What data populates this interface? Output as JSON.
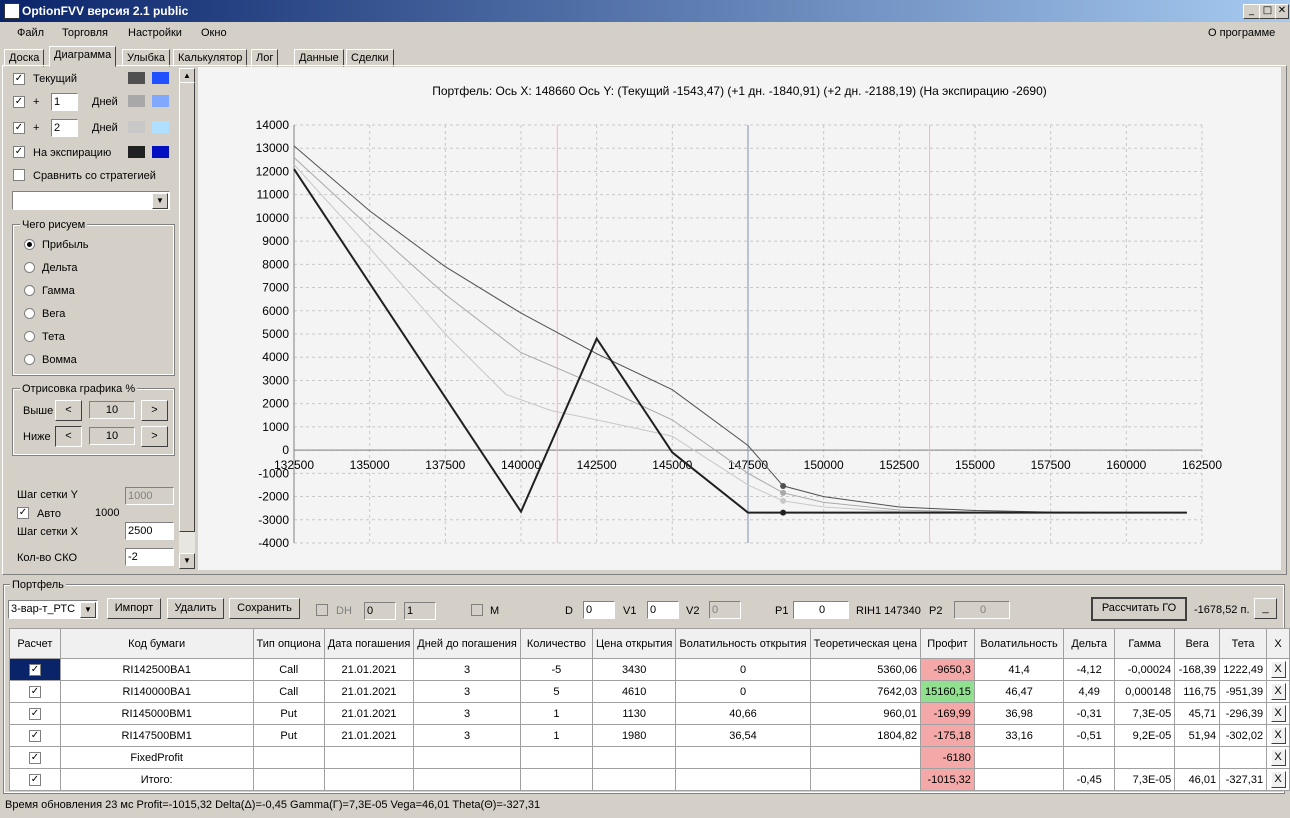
{
  "window": {
    "title": "OptionFVV версия 2.1 public",
    "min": "_",
    "max": "□",
    "close": "✕"
  },
  "menu": {
    "items": [
      "Файл",
      "Торговля",
      "Настройки",
      "Окно"
    ],
    "about": "О программе"
  },
  "tabs": [
    "Доска",
    "Диаграмма",
    "Улыбка",
    "Калькулятор",
    "Лог",
    "Данные",
    "Сделки"
  ],
  "left": {
    "current": {
      "label": "Текущий",
      "checked": true,
      "color1": "#505050",
      "color2": "#2050ff"
    },
    "plus1": {
      "plus": "+",
      "value": "1",
      "days": "Дней",
      "checked": true,
      "color1": "#a8a8a8",
      "color2": "#80a8ff"
    },
    "plus2": {
      "plus": "+",
      "value": "2",
      "days": "Дней",
      "checked": true,
      "color1": "#c8c8c8",
      "color2": "#b0e0ff"
    },
    "expiration": {
      "label": "На экспирацию",
      "checked": true,
      "color1": "#202020",
      "color2": "#0010c0"
    },
    "compare": {
      "label": "Сравнить со стратегией",
      "checked": false
    },
    "draw_group": {
      "title": "Чего рисуем",
      "options": [
        "Прибыль",
        "Дельта",
        "Гамма",
        "Вега",
        "Тета",
        "Вомма"
      ],
      "selected": 0
    },
    "render_group": {
      "title": "Отрисовка графика %",
      "upper_label": "Выше",
      "upper_value": "10",
      "lower_label": "Ниже",
      "lower_value": "10",
      "less": "<",
      "more": ">"
    },
    "grid_y": {
      "label": "Шаг сетки Y",
      "value": "1000"
    },
    "auto": {
      "label": "Авто",
      "value": "1000",
      "checked": true
    },
    "grid_x": {
      "label": "Шаг сетки X",
      "value": "2500"
    },
    "sko": {
      "label": "Кол-во СКО",
      "value": "-2"
    }
  },
  "chart_header": "Портфель:  Ось X:  148660  Ось Y:   (Текущий -1543,47)   (+1 дн. -1840,91)   (+2 дн. -2188,19)   (На экспирацию -2690)",
  "chart_data": {
    "type": "line",
    "xlim": [
      132500,
      162500
    ],
    "ylim": [
      -4000,
      14000
    ],
    "x_ticks": [
      132500,
      135000,
      137500,
      140000,
      142500,
      145000,
      147500,
      150000,
      152500,
      155000,
      157500,
      160000,
      162500
    ],
    "y_ticks": [
      14000,
      13000,
      12000,
      11000,
      10000,
      9000,
      8000,
      7000,
      6000,
      5000,
      4000,
      3000,
      2000,
      1000,
      0,
      -1000,
      -2000,
      -3000,
      -4000
    ],
    "grid": true,
    "cursor_x": 147500,
    "sko_lines_x": [
      141200,
      153500
    ],
    "series": [
      {
        "color": "#505050",
        "width": 1,
        "x": [
          132500,
          135000,
          137500,
          140000,
          142500,
          145000,
          147500,
          148660,
          150000,
          152500,
          155000,
          157500,
          160000,
          162000
        ],
        "y": [
          13100,
          10300,
          7900,
          5900,
          4150,
          2600,
          200,
          -1543,
          -2000,
          -2450,
          -2600,
          -2670,
          -2690,
          -2690
        ]
      },
      {
        "color": "#a8a8a8",
        "width": 1,
        "x": [
          132500,
          135000,
          137500,
          140000,
          142500,
          145000,
          147500,
          148660,
          150000,
          152500,
          155000,
          157500,
          160000,
          162000
        ],
        "y": [
          12600,
          9600,
          6700,
          4200,
          2800,
          1300,
          -1000,
          -1840,
          -2250,
          -2580,
          -2670,
          -2690,
          -2690,
          -2690
        ]
      },
      {
        "color": "#c8c8c8",
        "width": 1,
        "x": [
          132500,
          135000,
          137500,
          139500,
          141000,
          142500,
          145000,
          147500,
          148660,
          150000,
          152500,
          155000,
          157500,
          162000
        ],
        "y": [
          12300,
          8700,
          5000,
          2400,
          1700,
          1300,
          600,
          -1500,
          -2188,
          -2450,
          -2650,
          -2690,
          -2690,
          -2690
        ]
      },
      {
        "color": "#202020",
        "width": 2,
        "x": [
          132500,
          140000,
          142500,
          145000,
          147500,
          148660,
          150000,
          152500,
          155000,
          157500,
          160000,
          162000
        ],
        "y": [
          12100,
          -2650,
          4800,
          -100,
          -2690,
          -2690,
          -2690,
          -2690,
          -2690,
          -2690,
          -2690,
          -2690
        ]
      }
    ]
  },
  "portfolio": {
    "title": "Портфель",
    "strategy": "3-вар-т_РТС",
    "import": "Импорт",
    "delete": "Удалить",
    "save": "Сохранить",
    "dh": "DH",
    "dh1": "0",
    "dh2": "1",
    "m": "M",
    "d_label": "D",
    "d_value": "0",
    "v1_label": "V1",
    "v1_value": "0",
    "v2_label": "V2",
    "v2_value": "0",
    "p1_label": "P1",
    "p1_value": "0",
    "rih": "RIH1 147340",
    "p2_label": "P2",
    "p2_value": "0",
    "calc_go": "Рассчитать ГО",
    "go_value": "-1678,52 п.",
    "go_btn": "_"
  },
  "table": {
    "headers": [
      "Расчет",
      "Код бумаги",
      "Тип опциона",
      "Дата погашения",
      "Дней до погашения",
      "Количество",
      "Цена открытия",
      "Волатильность открытия",
      "Теоретическая цена",
      "Профит",
      "Волатильность",
      "Дельта",
      "Гамма",
      "Вега",
      "Тета",
      "X"
    ],
    "rows": [
      {
        "code": "RI142500BA1",
        "type": "Call",
        "date": "21.01.2021",
        "days": "3",
        "qty": "-5",
        "open": "3430",
        "vol_open": "0",
        "theo": "5360,06",
        "profit": "-9650,3",
        "vol": "41,4",
        "delta": "-4,12",
        "gamma": "-0,00024",
        "vega": "-168,39",
        "theta": "1222,49",
        "x": "X"
      },
      {
        "code": "RI140000BA1",
        "type": "Call",
        "date": "21.01.2021",
        "days": "3",
        "qty": "5",
        "open": "4610",
        "vol_open": "0",
        "theo": "7642,03",
        "profit": "15160,15",
        "vol": "46,47",
        "delta": "4,49",
        "gamma": "0,000148",
        "vega": "116,75",
        "theta": "-951,39",
        "x": "X"
      },
      {
        "code": "RI145000BM1",
        "type": "Put",
        "date": "21.01.2021",
        "days": "3",
        "qty": "1",
        "open": "1130",
        "vol_open": "40,66",
        "theo": "960,01",
        "profit": "-169,99",
        "vol": "36,98",
        "delta": "-0,31",
        "gamma": "7,3E-05",
        "vega": "45,71",
        "theta": "-296,39",
        "x": "X"
      },
      {
        "code": "RI147500BM1",
        "type": "Put",
        "date": "21.01.2021",
        "days": "3",
        "qty": "1",
        "open": "1980",
        "vol_open": "36,54",
        "theo": "1804,82",
        "profit": "-175,18",
        "vol": "33,16",
        "delta": "-0,51",
        "gamma": "9,2E-05",
        "vega": "51,94",
        "theta": "-302,02",
        "x": "X"
      },
      {
        "code": "FixedProfit",
        "type": "",
        "date": "",
        "days": "",
        "qty": "",
        "open": "",
        "vol_open": "",
        "theo": "",
        "profit": "-6180",
        "vol": "",
        "delta": "",
        "gamma": "",
        "vega": "",
        "theta": "",
        "x": "X"
      },
      {
        "code": "Итого:",
        "type": "",
        "date": "",
        "days": "",
        "qty": "",
        "open": "",
        "vol_open": "",
        "theo": "",
        "profit": "-1015,32",
        "vol": "",
        "delta": "-0,45",
        "gamma": "7,3E-05",
        "vega": "46,01",
        "theta": "-327,31",
        "x": "X"
      }
    ],
    "colors": {
      "neg": "#f4a8a8",
      "pos": "#90e090"
    }
  },
  "status": "Время обновления 23 мс   Profit=-1015,32 Delta(Δ)=-0,45 Gamma(Γ)=7,3E-05 Vega=46,01 Theta(Θ)=-327,31"
}
